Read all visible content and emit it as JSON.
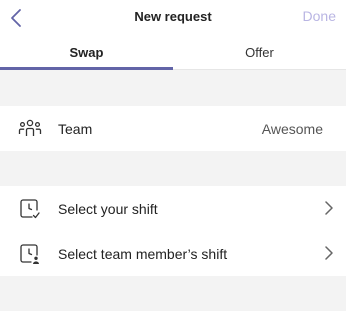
{
  "header": {
    "title": "New request",
    "done_label": "Done"
  },
  "tabs": [
    {
      "label": "Swap",
      "active": true
    },
    {
      "label": "Offer",
      "active": false
    }
  ],
  "team_row": {
    "label": "Team",
    "value": "Awesome",
    "icon": "team-icon"
  },
  "shift_rows": [
    {
      "label": "Select your shift",
      "icon": "clock-check-icon"
    },
    {
      "label": "Select team member’s shift",
      "icon": "clock-person-icon"
    }
  ],
  "colors": {
    "accent": "#6264a7",
    "done_disabled": "#b9b5e3",
    "background": "#f3f3f3"
  }
}
